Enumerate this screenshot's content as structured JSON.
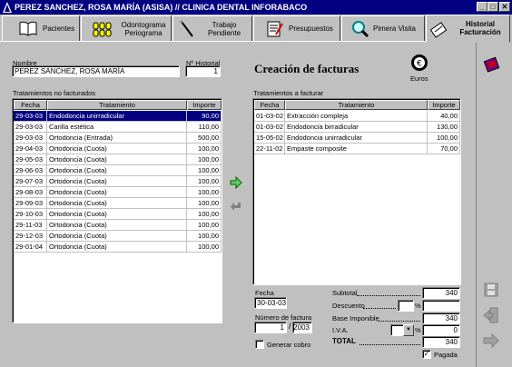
{
  "window": {
    "title": "PEREZ SANCHEZ, ROSA MARÍA (ASISA) // CLINICA DENTAL INFORABACO",
    "buttons": [
      "_",
      "□",
      "✕"
    ]
  },
  "tabs": [
    {
      "label": "Pacientes",
      "icon": "book-icon"
    },
    {
      "label": "Odontograma Periograma",
      "icon": "teeth-icon"
    },
    {
      "label": "Trabajo Pendiente",
      "icon": "instrument-icon"
    },
    {
      "label": "Presupuestos",
      "icon": "notepad-icon"
    },
    {
      "label": "Pimera Visita",
      "icon": "magnifier-icon"
    },
    {
      "label": "Historial Facturación",
      "icon": "stamp-icon"
    }
  ],
  "patient": {
    "name_label": "Nombre",
    "name_value": "PEREZ SANCHEZ, ROSA MARÍA",
    "history_label": "Nº Historial",
    "history_value": "1"
  },
  "heading": "Creación de facturas",
  "currency_label": "Euros",
  "left_table": {
    "caption": "Tratamientos no facturados",
    "columns": [
      "Fecha",
      "Tratamiento",
      "Importe"
    ],
    "rows": [
      [
        "29-03-03",
        "Endodoncia unirradicular",
        "90,00"
      ],
      [
        "29-03-03",
        "Carilla estética",
        "110,00"
      ],
      [
        "29-03-03",
        "Ortodoncia (Entrada)",
        "500,00"
      ],
      [
        "29-04-03",
        "Ortodoncia (Cuota)",
        "100,00"
      ],
      [
        "29-05-03",
        "Ortodoncia (Cuota)",
        "100,00"
      ],
      [
        "29-06-03",
        "Ortodoncia (Cuota)",
        "100,00"
      ],
      [
        "29-07-03",
        "Ortodoncia (Cuota)",
        "100,00"
      ],
      [
        "29-08-03",
        "Ortodoncia (Cuota)",
        "100,00"
      ],
      [
        "29-09-03",
        "Ortodoncia (Cuota)",
        "100,00"
      ],
      [
        "29-10-03",
        "Ortodoncia (Cuota)",
        "100,00"
      ],
      [
        "29-11-03",
        "Ortodoncia (Cuota)",
        "100,00"
      ],
      [
        "29-12-03",
        "Ortodoncia (Cuota)",
        "100,00"
      ],
      [
        "29-01-04",
        "Ortodoncia (Cuota)",
        "100,00"
      ]
    ]
  },
  "right_table": {
    "caption": "Tratamientos a facturar",
    "columns": [
      "Fecha",
      "Tratamiento",
      "Importe"
    ],
    "rows": [
      [
        "01-03-02",
        "Extracción compleja",
        "40,00"
      ],
      [
        "01-03-02",
        "Endodoncia birradicular",
        "130,00"
      ],
      [
        "15-05-02",
        "Endodoncia unirradicular",
        "100,00"
      ],
      [
        "22-11-02",
        "Empaste composite",
        "70,00"
      ]
    ]
  },
  "invoice": {
    "fecha_label": "Fecha",
    "fecha_value": "30-03-03",
    "numero_label": "Número de factura",
    "numero_value": "1",
    "numero_year": "2003",
    "generar_label": "Generar cobro",
    "subtotal_label": "Subtotal",
    "subtotal_value": "340",
    "descuento_label": "Descuento",
    "descuento_value": "",
    "base_label": "Base Imponible",
    "base_value": "340",
    "iva_label": "I.V.A.",
    "iva_value": "0",
    "total_label": "TOTAL",
    "total_value": "340",
    "pagada_label": "Pagada",
    "pagada_checked": "✓",
    "percent": "%"
  },
  "colors": {
    "titlebar": "#000080",
    "selection": "#000080",
    "face": "#c0c0c0"
  }
}
